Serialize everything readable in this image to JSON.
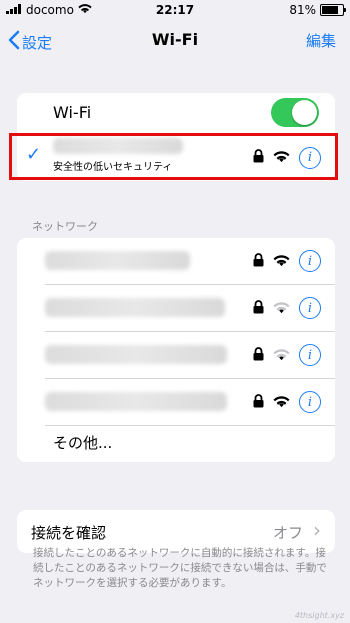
{
  "status_bar": {
    "carrier": "docomo",
    "time": "22:17",
    "battery": "81%",
    "battery_level": 0.81
  },
  "nav": {
    "back_label": "設定",
    "title": "Wi-Fi",
    "edit_label": "編集"
  },
  "wifi": {
    "label": "Wi-Fi",
    "enabled": true,
    "accent": "#34c759"
  },
  "connected": {
    "subtitle": "安全性の低いセキュリティ",
    "checkmark": "✓",
    "info": "i"
  },
  "networks": {
    "header": "ネットワーク",
    "items": [
      {
        "info": "i"
      },
      {
        "info": "i"
      },
      {
        "info": "i"
      },
      {
        "info": "i"
      }
    ],
    "other_label": "その他..."
  },
  "ask_to_join": {
    "label": "接続を確認",
    "value": "オフ",
    "chevron": "›"
  },
  "footer": {
    "text": "接続したことのあるネットワークに自動的に接続されます。接続したことのあるネットワークに接続できない場合は、手動でネットワークを選択する必要があります。"
  },
  "watermark": "4thsight.xyz",
  "colors": {
    "accent": "#1a7cf6",
    "highlight": "#e30d0d",
    "background": "#efeff4"
  },
  "icons": [
    "wifi-icon",
    "lock-icon",
    "info-icon",
    "checkmark-icon",
    "chevron-left-icon",
    "chevron-right-icon"
  ]
}
